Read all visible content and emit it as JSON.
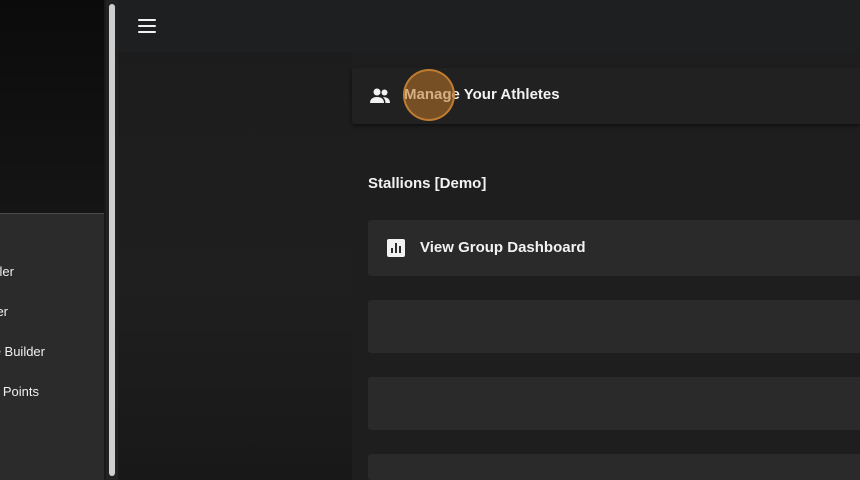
{
  "drawer": {
    "items": [
      {
        "label": "ler"
      },
      {
        "label": "er"
      },
      {
        "label": "e Builder"
      },
      {
        "label": "Points"
      }
    ]
  },
  "header": {
    "menu_icon": "menu-icon"
  },
  "athletes_card": {
    "icon": "people-icon",
    "title": "Manage Your Athletes"
  },
  "group": {
    "name": "Stallions [Demo]",
    "dashboard_card": {
      "icon": "bar-chart-icon",
      "label": "View Group Dashboard"
    }
  },
  "colors": {
    "accent_click": "#be7828",
    "background": "#1b1b1b",
    "card": "#2a2a2a"
  }
}
